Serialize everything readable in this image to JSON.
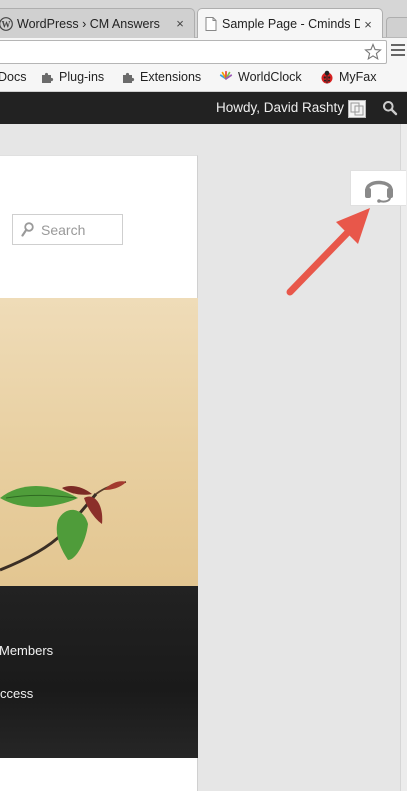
{
  "browser": {
    "tabs": [
      {
        "title": "WordPress › CM Answers",
        "favicon": "wordpress-icon",
        "close": "×"
      },
      {
        "title": "Sample Page - Cminds D",
        "favicon": "page-icon",
        "close": "×"
      }
    ],
    "bookmarks": [
      {
        "label": "Docs",
        "icon": ""
      },
      {
        "label": "Plug-ins",
        "icon": "puzzle-icon"
      },
      {
        "label": "Extensions",
        "icon": "puzzle-icon"
      },
      {
        "label": "WorldClock",
        "icon": "worldclock-icon"
      },
      {
        "label": "MyFax",
        "icon": "ladybug-icon"
      }
    ]
  },
  "admin_bar": {
    "greeting": "Howdy, David Rashty"
  },
  "site": {
    "search_placeholder": "Search",
    "nav_items": [
      {
        "label": "Members"
      },
      {
        "label": "ccess"
      }
    ]
  },
  "colors": {
    "admin_bar": "#222222",
    "arrow": "#e8574a",
    "page_bg": "#e6e6e6"
  }
}
